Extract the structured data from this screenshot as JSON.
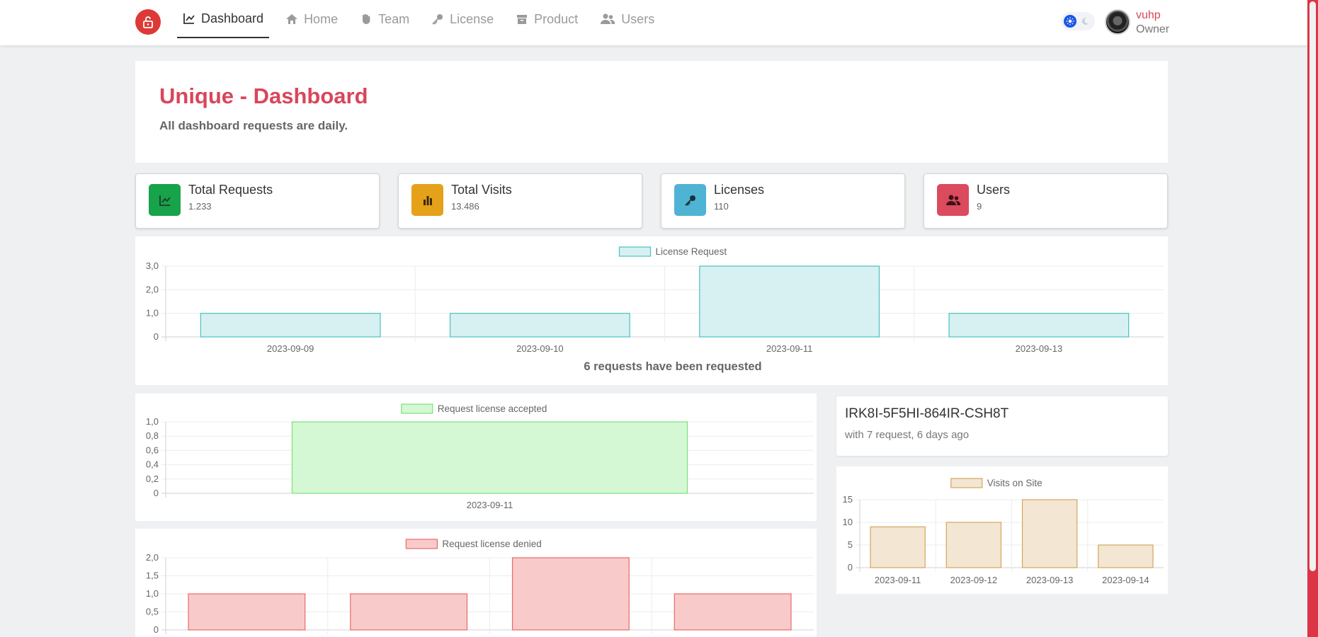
{
  "nav": {
    "items": [
      {
        "label": "Dashboard",
        "icon": "chart-line-icon",
        "active": true
      },
      {
        "label": "Home",
        "icon": "home-icon",
        "active": false
      },
      {
        "label": "Team",
        "icon": "hand-icon",
        "active": false
      },
      {
        "label": "License",
        "icon": "key-icon",
        "active": false
      },
      {
        "label": "Product",
        "icon": "box-icon",
        "active": false
      },
      {
        "label": "Users",
        "icon": "users-icon",
        "active": false
      }
    ]
  },
  "user": {
    "name": "vuhp",
    "role": "Owner"
  },
  "header": {
    "title": "Unique - Dashboard",
    "subtitle": "All dashboard requests are daily."
  },
  "stats": [
    {
      "label": "Total Requests",
      "value": "1.233",
      "color": "#16a34a",
      "icon": "chart-line-icon"
    },
    {
      "label": "Total Visits",
      "value": "13.486",
      "color": "#e5a11a",
      "icon": "bar-chart-icon"
    },
    {
      "label": "Licenses",
      "value": "110",
      "color": "#4fb3d4",
      "icon": "key-icon"
    },
    {
      "label": "Users",
      "value": "9",
      "color": "#dc4a5e",
      "icon": "users-icon"
    }
  ],
  "top_key": {
    "key": "IRK8I-5F5HI-864IR-CSH8T",
    "info": "with 7 request, 6 days ago"
  },
  "chart_data": [
    {
      "type": "bar",
      "id": "license-request",
      "categories": [
        "2023-09-09",
        "2023-09-10",
        "2023-09-11",
        "2023-09-13"
      ],
      "series": [
        {
          "name": "License Request",
          "values": [
            1,
            1,
            3,
            1
          ]
        }
      ],
      "yticks": [
        "0",
        "1,0",
        "2,0",
        "3,0"
      ],
      "ylim": [
        0,
        3
      ],
      "footer": "6 requests have been requested",
      "fill": "#d7f1f2",
      "stroke": "#4bc0c0",
      "legend": "top-center",
      "grid": true
    },
    {
      "type": "bar",
      "id": "license-accepted",
      "categories": [
        "2023-09-11"
      ],
      "series": [
        {
          "name": "Request license accepted",
          "values": [
            1
          ]
        }
      ],
      "yticks": [
        "0",
        "0,2",
        "0,4",
        "0,6",
        "0,8",
        "1,0"
      ],
      "ylim": [
        0,
        1
      ],
      "fill": "#d4f7d4",
      "stroke": "#7be27b",
      "legend": "top-center",
      "grid": true
    },
    {
      "type": "bar",
      "id": "license-denied",
      "categories": [
        "",
        "",
        "",
        ""
      ],
      "series": [
        {
          "name": "Request license denied",
          "values": [
            1,
            1,
            2,
            1
          ]
        }
      ],
      "yticks": [
        "0",
        "0,5",
        "1,0",
        "1,5",
        "2,0"
      ],
      "ylim": [
        0,
        2
      ],
      "fill": "#f9caca",
      "stroke": "#e86a6a",
      "legend": "top-center",
      "grid": true
    },
    {
      "type": "bar",
      "id": "visits-on-site",
      "categories": [
        "2023-09-11",
        "2023-09-12",
        "2023-09-13",
        "2023-09-14"
      ],
      "series": [
        {
          "name": "Visits on Site",
          "values": [
            9,
            10,
            15,
            5
          ]
        }
      ],
      "yticks": [
        "0",
        "5",
        "10",
        "15"
      ],
      "ylim": [
        0,
        15
      ],
      "fill": "#f3e6d2",
      "stroke": "#d4a65e",
      "legend": "top-center",
      "grid": true
    }
  ]
}
